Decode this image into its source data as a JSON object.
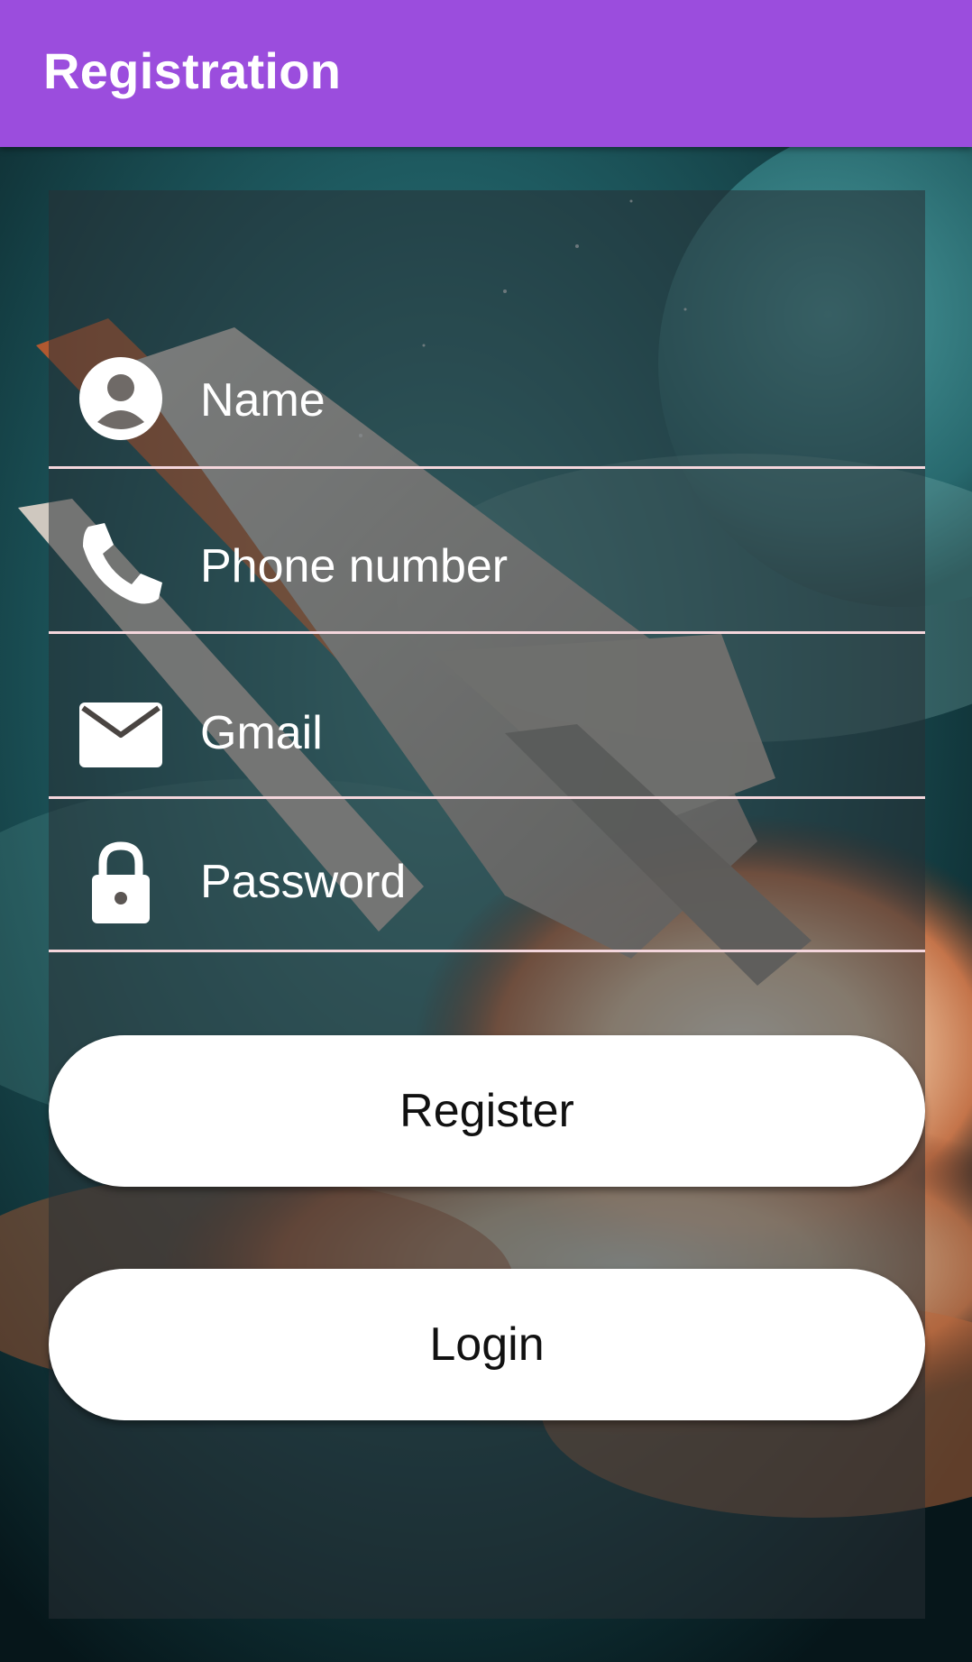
{
  "app_bar": {
    "title": "Registration"
  },
  "form": {
    "fields": [
      {
        "label": "Name",
        "icon": "account-circle-icon"
      },
      {
        "label": "Phone number",
        "icon": "phone-icon"
      },
      {
        "label": "Gmail",
        "icon": "mail-icon"
      },
      {
        "label": "Password",
        "icon": "lock-icon"
      }
    ],
    "register_label": "Register",
    "login_label": "Login"
  },
  "colors": {
    "app_bar": "#9b4ddd",
    "underline": "#f4d6dc",
    "button": "#ffffff"
  }
}
